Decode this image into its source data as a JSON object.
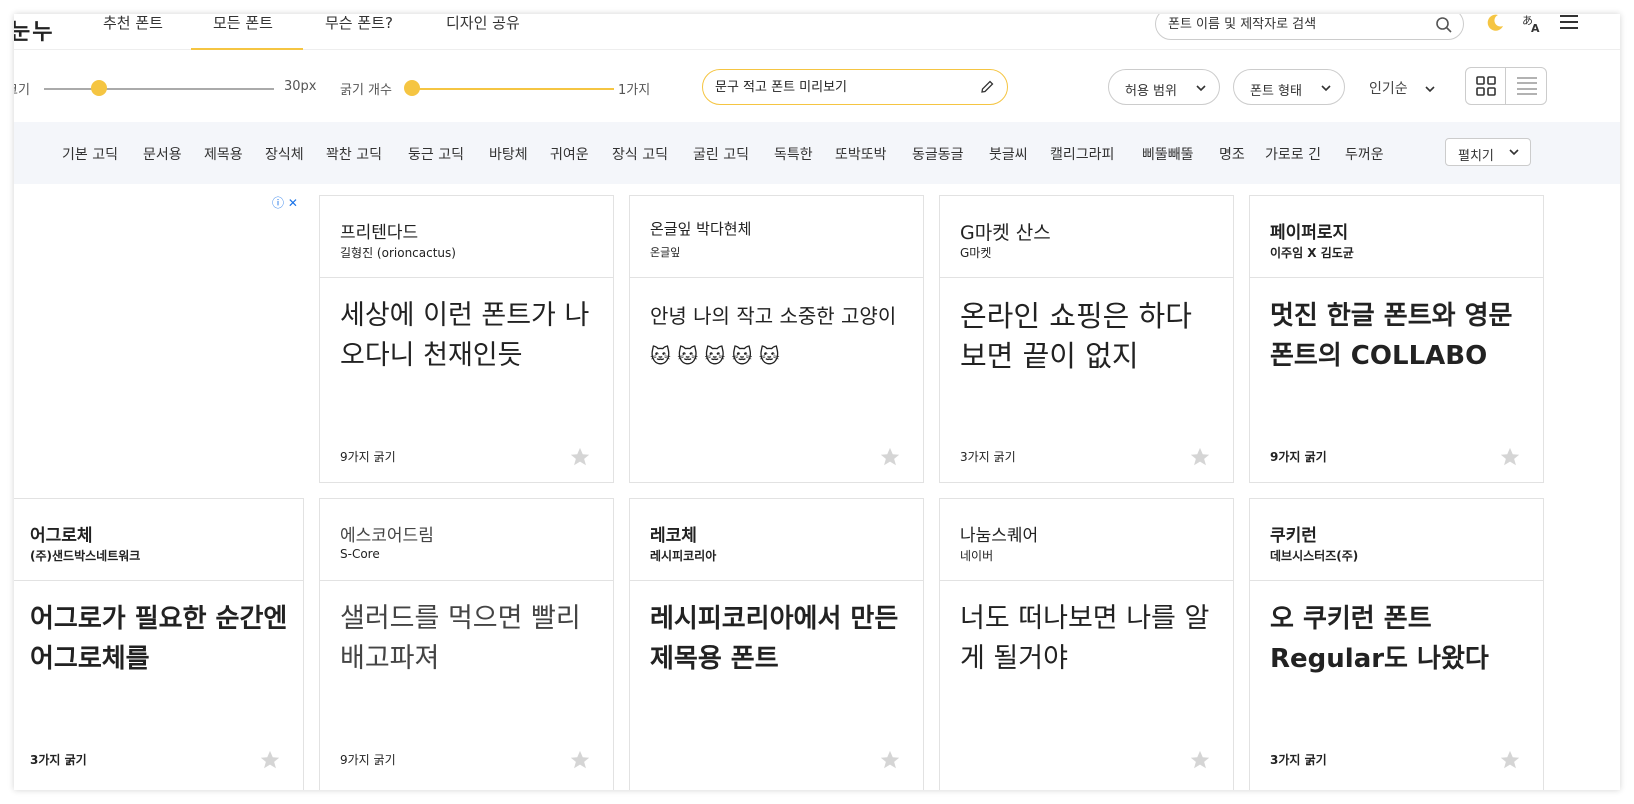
{
  "logo": "눈누",
  "nav": {
    "items": [
      {
        "label": "추천 폰트"
      },
      {
        "label": "모든 폰트"
      },
      {
        "label": "무슨 폰트?"
      },
      {
        "label": "디자인 공유"
      }
    ],
    "active": "모든 폰트",
    "search_placeholder": "폰트 이름 및 제작자로 검색"
  },
  "toolbar": {
    "size_label": "크기",
    "size_value": "30px",
    "weight_label": "굵기 개수",
    "weight_value": "1가지",
    "preview_placeholder": "문구 적고 폰트 미리보기",
    "license_filter": "허용 범위",
    "type_filter": "폰트 형태",
    "sort": "인기순"
  },
  "categories": [
    "기본 고딕",
    "문서용",
    "제목용",
    "장식체",
    "꽉찬 고딕",
    "둥근 고딕",
    "바탕체",
    "귀여운",
    "장식 고딕",
    "굴린 고딕",
    "독특한",
    "또박또박",
    "동글동글",
    "붓글씨",
    "캘리그라피",
    "삐뚤빼뚤",
    "명조",
    "가로로 긴",
    "두꺼운"
  ],
  "expand_label": "펼치기",
  "ad": {
    "icons": "ⓘ ✕"
  },
  "cards": [
    {
      "name": "프리텐다드",
      "maker": "길형진 (orioncactus)",
      "sample": "세상에 이런 폰트가 나오다니 천재인듯",
      "weights": "9가지 굵기"
    },
    {
      "name": "온글잎 박다현체",
      "maker": "온글잎",
      "sample": "안녕 나의 작고 소중한 고양이 🐱 🐱 🐱 🐱 🐱",
      "weights": ""
    },
    {
      "name": "G마켓 산스",
      "maker": "G마켓",
      "sample": "온라인 쇼핑은 하다 보면 끝이 없지",
      "weights": "3가지 굵기"
    },
    {
      "name": "페이퍼로지",
      "maker": "이주임 X 김도균",
      "sample": "멋진 한글 폰트와 영문 폰트의 COLLABO",
      "weights": "9가지 굵기"
    },
    {
      "name": "어그로체",
      "maker": "(주)샌드박스네트워크",
      "sample": "어그로가 필요한 순간엔 어그로체를",
      "weights": "3가지 굵기"
    },
    {
      "name": "에스코어드림",
      "maker": "S-Core",
      "sample": "샐러드를 먹으면 빨리 배고파져",
      "weights": "9가지 굵기"
    },
    {
      "name": "레코체",
      "maker": "레시피코리아",
      "sample": "레시피코리아에서 만든 제목용 폰트",
      "weights": ""
    },
    {
      "name": "나눔스퀘어",
      "maker": "네이버",
      "sample": "너도 떠나보면 나를 알게 될거야",
      "weights": ""
    },
    {
      "name": "쿠키런",
      "maker": "데브시스터즈(주)",
      "sample": "오 쿠키런 폰트 Regular도 나왔다",
      "weights": "3가지 굵기"
    }
  ],
  "colors": {
    "accent": "#f5c542",
    "category_bg": "#f4f6fa",
    "border": "#e2e2e2"
  }
}
